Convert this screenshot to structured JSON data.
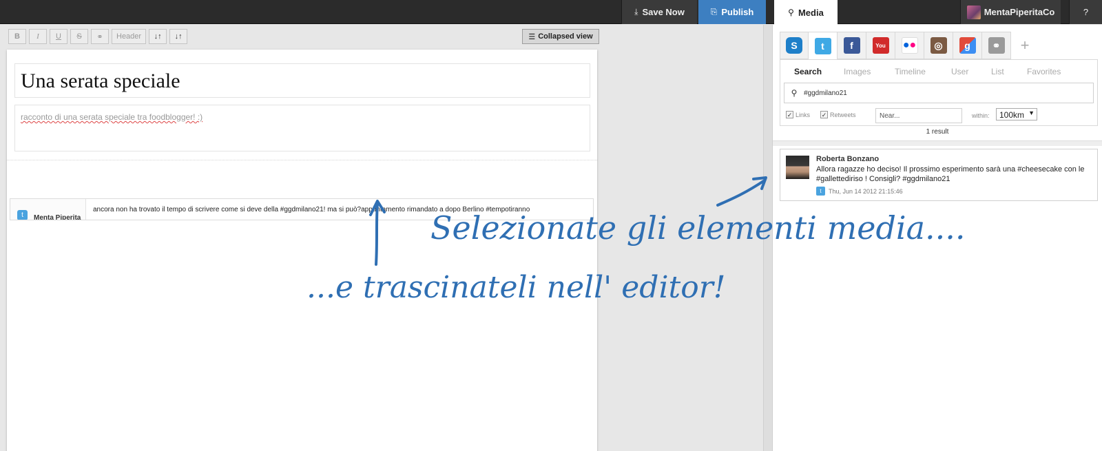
{
  "topbar": {
    "save_label": "Save Now",
    "publish_label": "Publish",
    "media_label": "Media",
    "user_label": "MentaPiperitaCo",
    "help_label": "?"
  },
  "editor": {
    "toolbar": {
      "bold": "B",
      "italic": "I",
      "underline": "U",
      "strike": "S",
      "link": "⚭",
      "header": "Header",
      "sort_down": "↓↑",
      "sort_up": "↓↑",
      "collapsed_view": "Collapsed view"
    },
    "title": "Una serata speciale",
    "description": "racconto di una serata speciale tra foodblogger! :)",
    "tweet_embed": {
      "user": "Menta Piperita",
      "text": "ancora non ha trovato il tempo di scrivere come si deve della #ggdmilano21! ma si può?appuntamento rimandato a dopo Berlino #tempotiranno"
    }
  },
  "media": {
    "services": [
      "storify-icon",
      "twitter-icon",
      "facebook-icon",
      "youtube-icon",
      "flickr-icon",
      "instagram-icon",
      "google-icon",
      "link-icon"
    ],
    "add_label": "+",
    "search_tabs": [
      "Search",
      "Images",
      "Timeline",
      "User",
      "List",
      "Favorites"
    ],
    "query": "#ggdmilano21",
    "options": {
      "links_label": "Links",
      "retweets_label": "Retweets",
      "near_placeholder": "Near...",
      "within_label": "within:",
      "within_value": "100km"
    },
    "result_count": "1 result",
    "result": {
      "name": "Roberta Bonzano",
      "text": "Allora ragazze ho deciso! Il prossimo esperimento sarà una #cheesecake con le #gallettediriso ! Consigli? #ggdmilano21",
      "timestamp": "Thu, Jun 14 2012 21:15:46"
    }
  },
  "annotations": {
    "select_text": "Selezionate gli elementi media....",
    "drag_text": "...e trascinateli nell' editor!",
    "color": "#2f6fb3"
  }
}
